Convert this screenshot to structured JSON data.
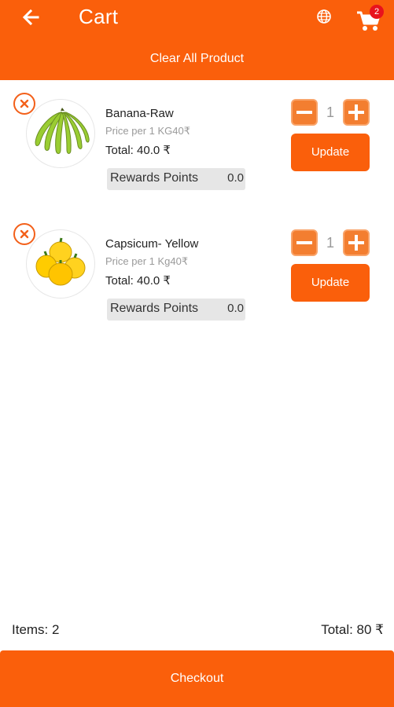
{
  "header": {
    "title": "Cart",
    "cart_badge": "2",
    "clear_all_label": "Clear All Product",
    "icons": [
      "back-arrow-icon",
      "globe-icon",
      "cart-icon"
    ]
  },
  "items": [
    {
      "name": "Banana-Raw",
      "price": "Price per 1 KG40₹",
      "total": "Total: 40.0 ₹",
      "qty": "1",
      "update_label": "Update",
      "rewards_label": "Rewards Points",
      "rewards_value": "0.0"
    },
    {
      "name": "Capsicum- Yellow",
      "price": "Price per 1 Kg40₹",
      "total": "Total: 40.0 ₹",
      "qty": "1",
      "update_label": "Update",
      "rewards_label": "Rewards Points",
      "rewards_value": "0.0"
    }
  ],
  "footer": {
    "items_count": "Items: 2",
    "total": "Total: 80 ₹",
    "checkout_label": "Checkout"
  },
  "colors": {
    "accent": "#fa5f0b",
    "qty_button": "#f37e30",
    "badge": "#e8121d"
  }
}
